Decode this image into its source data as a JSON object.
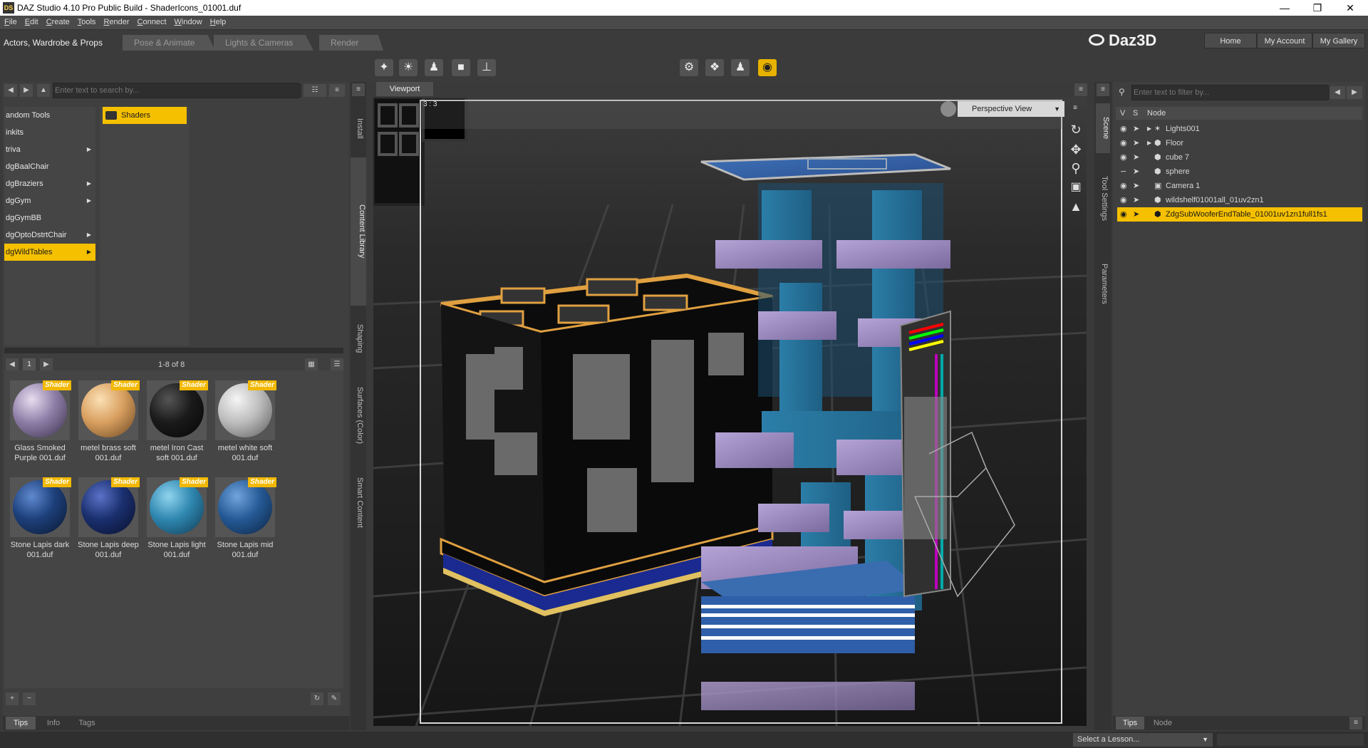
{
  "window": {
    "title": "DAZ Studio 4.10 Pro Public Build - ShaderIcons_01001.duf",
    "app_icon": "DS",
    "controls": [
      "minimize-icon",
      "maximize-icon",
      "close-icon"
    ]
  },
  "menu": [
    "File",
    "Edit",
    "Create",
    "Tools",
    "Render",
    "Connect",
    "Window",
    "Help"
  ],
  "rooms": [
    "Actors, Wardrobe & Props",
    "Pose & Animate",
    "Lights & Cameras",
    "Render"
  ],
  "brand": {
    "name": "Daz3D",
    "buttons": [
      "Home",
      "My Account",
      "My Gallery"
    ]
  },
  "content_library": {
    "search_placeholder": "Enter text to search by...",
    "folders": [
      {
        "label": "andom Tools",
        "arrow": false
      },
      {
        "label": "inkits",
        "arrow": false
      },
      {
        "label": "triva",
        "arrow": true
      },
      {
        "label": "dgBaalChair",
        "arrow": false
      },
      {
        "label": "dgBraziers",
        "arrow": true
      },
      {
        "label": "dgGym",
        "arrow": true
      },
      {
        "label": "dgGymBB",
        "arrow": false
      },
      {
        "label": "dgOptoDstrtChair",
        "arrow": true
      },
      {
        "label": "dgWildTables",
        "arrow": true,
        "selected": true
      }
    ],
    "subfolder": "Shaders",
    "page": "1",
    "page_count": "1-8 of 8",
    "badge": "Shader",
    "items": [
      {
        "line1": "Glass Smoked",
        "line2": "Purple 001.duf",
        "color": "#8f7fa8"
      },
      {
        "line1": "metel brass soft",
        "line2": "001.duf",
        "color": "#d9a060"
      },
      {
        "line1": "metel Iron Cast",
        "line2": "soft 001.duf",
        "color": "#1a1a1a"
      },
      {
        "line1": "metel white soft",
        "line2": "001.duf",
        "color": "#bdbdbd"
      },
      {
        "line1": "Stone Lapis dark",
        "line2": "001.duf",
        "color": "#1d3f7a"
      },
      {
        "line1": "Stone Lapis deep",
        "line2": "001.duf",
        "color": "#1a2f6e"
      },
      {
        "line1": "Stone Lapis light",
        "line2": "001.duf",
        "color": "#2f87b0"
      },
      {
        "line1": "Stone Lapis mid",
        "line2": "001.duf",
        "color": "#255a96"
      }
    ],
    "side_tabs": [
      "Install",
      "Content Library",
      "Shaping",
      "Surfaces (Color)",
      "Smart Content"
    ],
    "bottom_tabs": [
      "Tips",
      "Info",
      "Tags"
    ]
  },
  "viewport": {
    "tab": "Viewport",
    "view_mode": "Perspective View",
    "label": "3 : 3"
  },
  "scene": {
    "filter_placeholder": "Enter text to filter by...",
    "columns": [
      "V",
      "S",
      "Node"
    ],
    "nodes": [
      {
        "label": "Lights001",
        "icon": "lights-icon",
        "expand": true
      },
      {
        "label": "Floor",
        "icon": "prop-icon",
        "expand": true
      },
      {
        "label": "cube 7",
        "icon": "prop-icon",
        "expand": false
      },
      {
        "label": "sphere",
        "icon": "prop-icon",
        "expand": false
      },
      {
        "label": "Camera 1",
        "icon": "camera-icon",
        "expand": false
      },
      {
        "label": "wildshelf01001all_01uv2zn1",
        "icon": "prop-icon",
        "expand": false
      },
      {
        "label": "ZdgSubWooferEndTable_01001uv1zn1full1fs1",
        "icon": "prop-icon",
        "expand": false,
        "selected": true
      }
    ],
    "side_tabs": [
      "Scene",
      "Tool Settings",
      "Parameters"
    ],
    "bottom_tabs": [
      "Tips",
      "Node"
    ],
    "lesson_select": "Select a Lesson..."
  }
}
